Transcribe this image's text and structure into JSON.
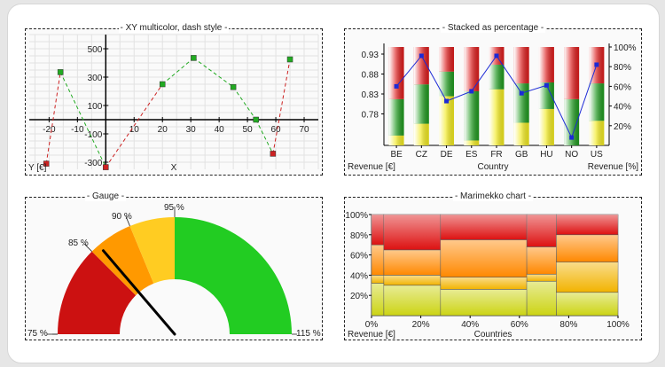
{
  "chart_data": [
    {
      "type": "line",
      "title": "- XY multicolor, dash style -",
      "xlabel": "X",
      "ylabel": "Y [€]",
      "xlim": [
        -27,
        75
      ],
      "ylim": [
        -350,
        600
      ],
      "xticks": [
        -20,
        -10,
        10,
        20,
        30,
        40,
        50,
        60,
        70
      ],
      "yticks": [
        -300,
        -100,
        100,
        300,
        500
      ],
      "grid": true,
      "points": [
        {
          "x": -21,
          "y": -310,
          "color": "#cc2222"
        },
        {
          "x": -16,
          "y": 335,
          "color": "#22aa22"
        },
        {
          "x": 0,
          "y": -335,
          "color": "#cc2222"
        },
        {
          "x": 20,
          "y": 250,
          "color": "#22aa22"
        },
        {
          "x": 31,
          "y": 435,
          "color": "#22aa22"
        },
        {
          "x": 45,
          "y": 230,
          "color": "#22aa22"
        },
        {
          "x": 53,
          "y": 0,
          "color": "#22aa22"
        },
        {
          "x": 59,
          "y": -240,
          "color": "#cc2222"
        },
        {
          "x": 65,
          "y": 425,
          "color": "#22aa22"
        }
      ]
    },
    {
      "type": "bar",
      "stacked": "percentage",
      "title": "- Stacked as percentage -",
      "categories": [
        "BE",
        "CZ",
        "DE",
        "ES",
        "FR",
        "GB",
        "HU",
        "NO",
        "US"
      ],
      "xlabel": "Country",
      "ylabel": "Revenue [€]",
      "y2label": "Revenue [%]",
      "yticks_left": [
        "0.93",
        "0.88",
        "0.83",
        "0.78"
      ],
      "yticks_right": [
        "100%",
        "80%",
        "60%",
        "40%",
        "20%"
      ],
      "series": [
        {
          "color": "#f2ea1f",
          "values": [
            10,
            22,
            50,
            5,
            57,
            23,
            37,
            0,
            25
          ]
        },
        {
          "color": "#1f9a1f",
          "values": [
            37,
            40,
            25,
            50,
            25,
            40,
            27,
            47,
            38
          ]
        },
        {
          "color": "#dd1c1c",
          "values": [
            53,
            38,
            25,
            45,
            18,
            37,
            36,
            53,
            37
          ]
        }
      ],
      "line": {
        "color": "#1c2ad6",
        "values": [
          60,
          91,
          45,
          55,
          91,
          53,
          61,
          8,
          82
        ]
      }
    },
    {
      "type": "gauge",
      "title": "- Gauge -",
      "range": [
        75,
        115
      ],
      "needle": 86,
      "bands": [
        {
          "from": 75,
          "to": 85,
          "color": "#cc1111"
        },
        {
          "from": 85,
          "to": 90,
          "color": "#ff9900"
        },
        {
          "from": 90,
          "to": 95,
          "color": "#ffcc22"
        },
        {
          "from": 95,
          "to": 115,
          "color": "#22cc22"
        }
      ],
      "labels": [
        "75 %",
        "85 %",
        "90 %",
        "95 %",
        "115 %"
      ]
    },
    {
      "type": "marimekko",
      "title": "- Marimekko chart -",
      "xlabel": "Countries",
      "ylabel": "Revenue [€]",
      "xticks": [
        "0%",
        "20%",
        "40%",
        "60%",
        "80%",
        "100%"
      ],
      "yticks": [
        "100%",
        "80%",
        "60%",
        "40%",
        "20%"
      ],
      "columns": [
        {
          "width": 5,
          "segments": [
            32,
            8,
            30,
            30
          ]
        },
        {
          "width": 23,
          "segments": [
            30,
            10,
            25,
            35
          ]
        },
        {
          "width": 35,
          "segments": [
            26,
            12,
            37,
            25
          ]
        },
        {
          "width": 12,
          "segments": [
            34,
            7,
            27,
            32
          ]
        },
        {
          "width": 25,
          "segments": [
            23,
            30,
            27,
            20
          ]
        }
      ],
      "colors": [
        "#ccd414",
        "#f2b300",
        "#ff8800",
        "#dd1111"
      ]
    }
  ]
}
